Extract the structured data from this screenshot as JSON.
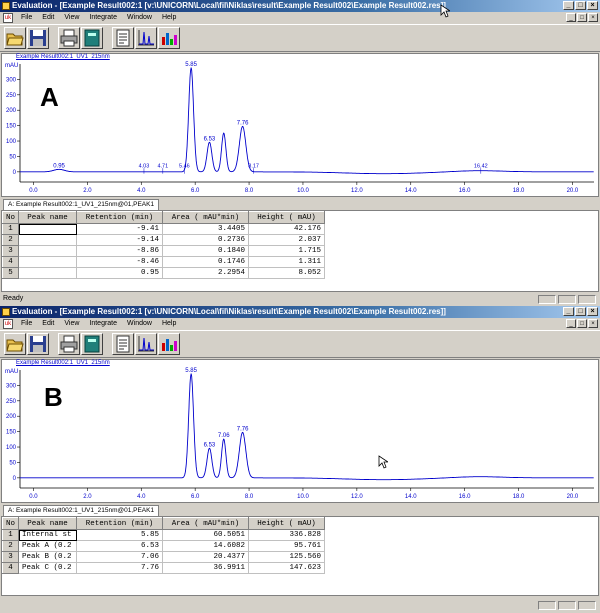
{
  "windows": [
    {
      "id": "A",
      "title": "Evaluation - [Example Result002:1   [v:\\UNICORN\\Local\\fil\\Niklas\\result\\Example Result002\\Example Result002.res]]",
      "menu": [
        "File",
        "Edit",
        "View",
        "Integrate",
        "Window",
        "Help"
      ],
      "curve_name": "Example Result002:1_UV1_215nm",
      "y_unit": "mAU",
      "panel_label": "A",
      "tab_label": "A: Example Result002:1_UV1_215nm@01,PEAK1",
      "status": "Ready",
      "table": {
        "headers": [
          "No",
          "Peak name",
          "Retention (min)",
          "Area ( mAU*min)",
          "Height ( mAU)"
        ],
        "rows": [
          {
            "no": "1",
            "name": "",
            "ret": "-9.41",
            "area": "3.4405",
            "height": "42.176"
          },
          {
            "no": "2",
            "name": "",
            "ret": "-9.14",
            "area": "0.2736",
            "height": "2.037"
          },
          {
            "no": "3",
            "name": "",
            "ret": "-8.86",
            "area": "0.1840",
            "height": "1.715"
          },
          {
            "no": "4",
            "name": "",
            "ret": "-8.46",
            "area": "0.1746",
            "height": "1.311"
          },
          {
            "no": "5",
            "name": "",
            "ret": "0.95",
            "area": "2.2954",
            "height": "8.052"
          }
        ]
      }
    },
    {
      "id": "B",
      "title": "Evaluation - [Example Result002:1   [v:\\UNICORN\\Local\\fil\\Niklas\\result\\Example Result002\\Example Result002.res]]",
      "menu": [
        "File",
        "Edit",
        "View",
        "Integrate",
        "Window",
        "Help"
      ],
      "curve_name": "Example Result002:1_UV1_215nm",
      "y_unit": "mAU",
      "panel_label": "B",
      "tab_label": "A: Example Result002:1_UV1_215nm@01,PEAK1",
      "status": "",
      "table": {
        "headers": [
          "No",
          "Peak name",
          "Retention (min)",
          "Area ( mAU*min)",
          "Height ( mAU)"
        ],
        "rows": [
          {
            "no": "1",
            "name": "Internal st",
            "ret": "5.85",
            "area": "60.5051",
            "height": "336.828"
          },
          {
            "no": "2",
            "name": "Peak A (0.2",
            "ret": "6.53",
            "area": "14.6082",
            "height": "95.761"
          },
          {
            "no": "3",
            "name": "Peak B (0.2",
            "ret": "7.06",
            "area": "20.4377",
            "height": "125.560"
          },
          {
            "no": "4",
            "name": "Peak C (0.2",
            "ret": "7.76",
            "area": "36.9911",
            "height": "147.623"
          }
        ]
      }
    }
  ],
  "toolbar_icons": [
    "open-folder-icon",
    "save-disk-icon",
    "print-icon",
    "notebook-icon",
    "report-icon",
    "chromatogram-icon",
    "bar-chart-icon"
  ],
  "chart_data": [
    {
      "type": "line",
      "panel": "A",
      "ylabel": "mAU",
      "xlim": [
        -0.5,
        20.8
      ],
      "ylim": [
        -20,
        350
      ],
      "x_ticks": [
        "0.0",
        "2.0",
        "4.0",
        "6.0",
        "8.0",
        "10.0",
        "12.0",
        "14.0",
        "16.0",
        "18.0",
        "20.0"
      ],
      "y_ticks": [
        "0",
        "50",
        "100",
        "150",
        "200",
        "250",
        "300"
      ],
      "peaks": [
        {
          "rt": 5.85,
          "height": 336.8,
          "label": "5.85"
        },
        {
          "rt": 6.53,
          "height": 95.8,
          "label": "6.53"
        },
        {
          "rt": 7.06,
          "height": 125.6,
          "label": ""
        },
        {
          "rt": 7.76,
          "height": 147.6,
          "label": "7.76"
        },
        {
          "rt": 0.95,
          "height": 8.1,
          "label": "0.95"
        }
      ],
      "marker_labels": [
        {
          "rt": 0.95,
          "label": "0.95"
        },
        {
          "rt": 4.1,
          "label": "4.03"
        },
        {
          "rt": 4.8,
          "label": "4.71"
        },
        {
          "rt": 5.6,
          "label": "5.46"
        },
        {
          "rt": 8.17,
          "label": "8.17"
        },
        {
          "rt": 16.6,
          "label": "16.42"
        }
      ]
    },
    {
      "type": "line",
      "panel": "B",
      "ylabel": "mAU",
      "xlim": [
        -0.5,
        20.8
      ],
      "ylim": [
        -20,
        350
      ],
      "x_ticks": [
        "0.0",
        "2.0",
        "4.0",
        "6.0",
        "8.0",
        "10.0",
        "12.0",
        "14.0",
        "16.0",
        "18.0",
        "20.0"
      ],
      "y_ticks": [
        "0",
        "50",
        "100",
        "150",
        "200",
        "250",
        "300"
      ],
      "peaks": [
        {
          "rt": 5.85,
          "height": 336.8,
          "label": "5.85"
        },
        {
          "rt": 6.53,
          "height": 95.8,
          "label": "6.53"
        },
        {
          "rt": 7.06,
          "height": 125.6,
          "label": "7.06"
        },
        {
          "rt": 7.76,
          "height": 147.6,
          "label": "7.76"
        }
      ]
    }
  ]
}
